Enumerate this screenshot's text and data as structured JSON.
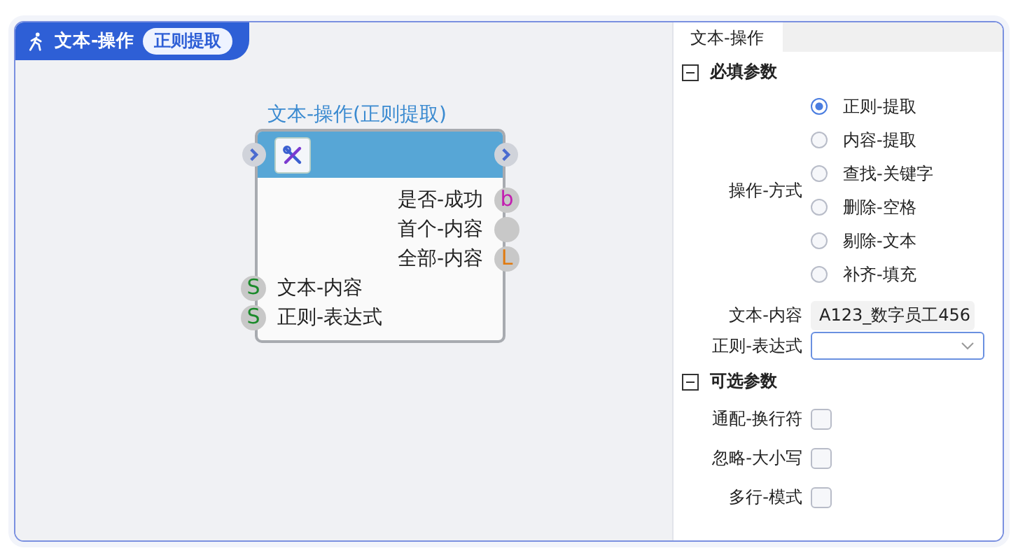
{
  "header": {
    "title": "文本-操作",
    "badge": "正则提取"
  },
  "node": {
    "title": "文本-操作(正则提取)",
    "outputs": [
      {
        "label": "是否-成功",
        "port": "b",
        "kind": "bool"
      },
      {
        "label": "首个-内容",
        "kind": "any"
      },
      {
        "label": "全部-内容",
        "port": "L",
        "kind": "list"
      }
    ],
    "inputs": [
      {
        "label": "文本-内容",
        "port": "S",
        "kind": "string"
      },
      {
        "label": "正则-表达式",
        "port": "S",
        "kind": "string"
      }
    ]
  },
  "panel": {
    "tab": "文本-操作",
    "sections": [
      {
        "title": "必填参数",
        "expanded": true,
        "fields": [
          {
            "kind": "radio",
            "label": "操作-方式",
            "options": [
              {
                "label": "正则-提取",
                "selected": true
              },
              {
                "label": "内容-提取",
                "selected": false
              },
              {
                "label": "查找-关键字",
                "selected": false
              },
              {
                "label": "删除-空格",
                "selected": false
              },
              {
                "label": "剔除-文本",
                "selected": false
              },
              {
                "label": "补齐-填充",
                "selected": false
              }
            ]
          },
          {
            "kind": "text",
            "label": "文本-内容",
            "value": "A123_数字员工456"
          },
          {
            "kind": "dropdown",
            "label": "正则-表达式"
          }
        ]
      },
      {
        "title": "可选参数",
        "expanded": true,
        "fields": [
          {
            "kind": "checkbox",
            "label": "通配-换行符",
            "checked": false
          },
          {
            "kind": "checkbox",
            "label": "忽略-大小写",
            "checked": false
          },
          {
            "kind": "checkbox",
            "label": "多行-模式",
            "checked": false
          }
        ]
      }
    ]
  }
}
